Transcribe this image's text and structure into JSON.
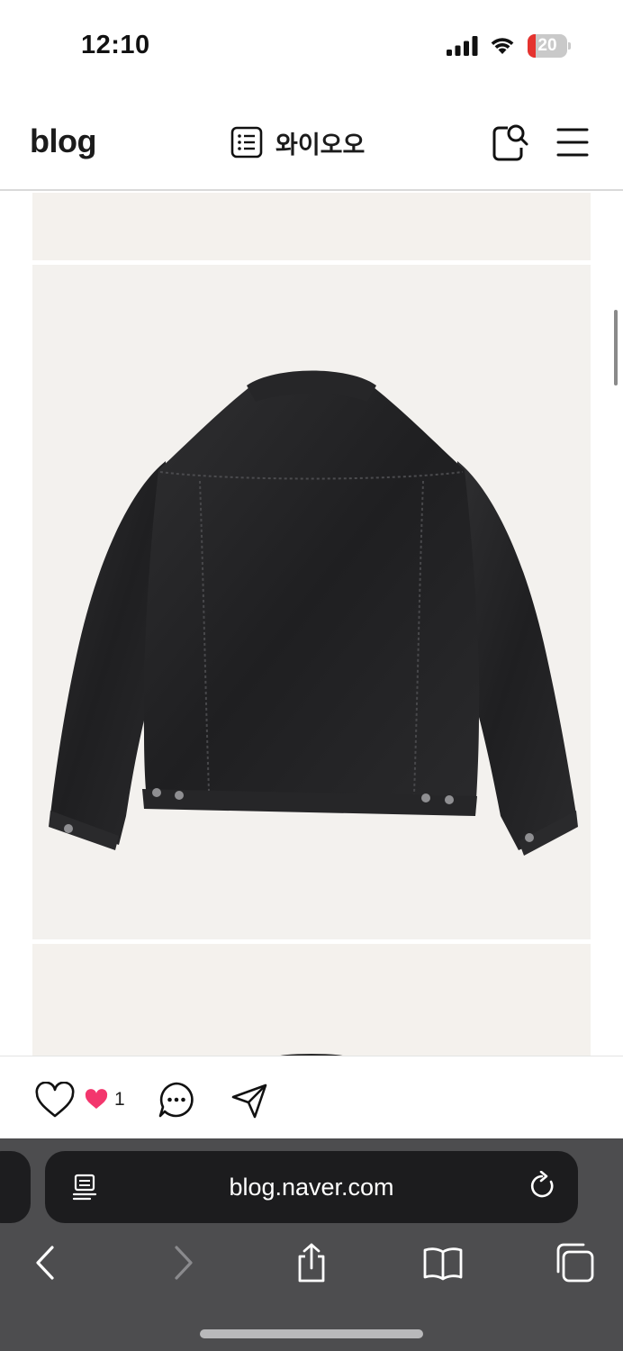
{
  "status_bar": {
    "time": "12:10",
    "battery_level": "20",
    "battery_fraction": 0.2
  },
  "header": {
    "logo": "blog",
    "blog_name": "와이오오",
    "icons": [
      "list-icon",
      "search-icon",
      "menu-icon"
    ]
  },
  "post": {
    "images": [
      "photo-partial-top",
      "denim-jacket-back-photo",
      "photo-partial-bottom"
    ]
  },
  "reactions": {
    "like_count": "1",
    "icons": [
      "heart-outline-icon",
      "heart-filled-icon",
      "comment-icon",
      "share-icon"
    ]
  },
  "browser": {
    "url": "blog.naver.com",
    "toolbar_icons": [
      "back-icon",
      "forward-icon",
      "share-icon",
      "bookmarks-icon",
      "tabs-icon"
    ]
  },
  "colors": {
    "battery_low": "#e5332f",
    "heart_pink": "#f3366d",
    "photo_background": "#f3f1ee",
    "browser_toolbar": "#4d4d4f",
    "url_bar": "#1c1c1e"
  }
}
